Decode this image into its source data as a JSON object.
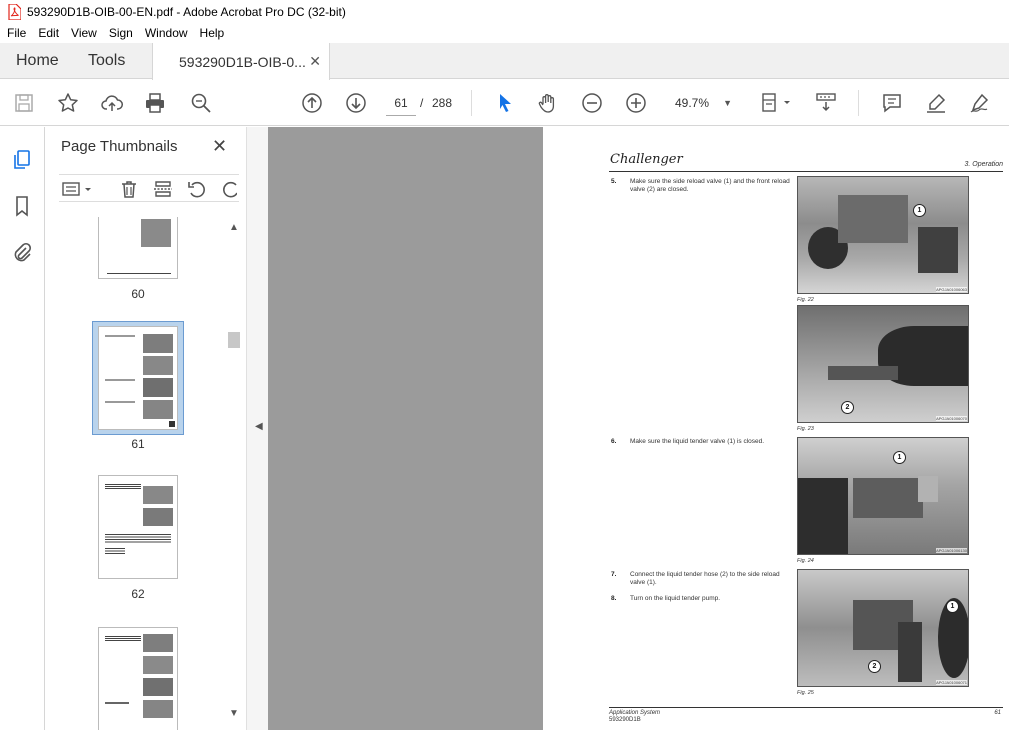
{
  "window": {
    "title": "593290D1B-OIB-00-EN.pdf - Adobe Acrobat Pro DC (32-bit)"
  },
  "menu": [
    "File",
    "Edit",
    "View",
    "Sign",
    "Window",
    "Help"
  ],
  "tabs": {
    "home": "Home",
    "tools": "Tools",
    "document": "593290D1B-OIB-0..."
  },
  "toolbar": {
    "page_current": "61",
    "page_separator": "/",
    "page_total": "288",
    "zoom": "49.7%"
  },
  "panel": {
    "title": "Page Thumbnails"
  },
  "thumbnails": [
    {
      "label": "60"
    },
    {
      "label": "61",
      "selected": true
    },
    {
      "label": "62"
    },
    {
      "label": ""
    }
  ],
  "page": {
    "brand": "Challenger",
    "section": "3. Operation",
    "steps": [
      {
        "num": "5.",
        "text": "Make sure the side reload valve (1) and the front reload valve (2) are closed."
      },
      {
        "num": "6.",
        "text": "Make sure the liquid tender valve (1) is closed."
      },
      {
        "num": "7.",
        "text": "Connect the liquid tender hose (2) to the side reload valve (1)."
      },
      {
        "num": "8.",
        "text": "Turn on the liquid tender pump."
      }
    ],
    "figures": [
      {
        "caption": "Fig. 22",
        "code": "APGJA01006063"
      },
      {
        "caption": "Fig. 23",
        "code": "APGJA01006070"
      },
      {
        "caption": "Fig. 24",
        "code": "APGJA01006130"
      },
      {
        "caption": "Fig. 25",
        "code": "APGJA01006071"
      }
    ],
    "callouts": {
      "one": "1",
      "two": "2"
    },
    "footer_left1": "Application System",
    "footer_left2": "593290D1B",
    "footer_page": "61"
  },
  "colors": {
    "accent": "#1473e6",
    "pdf_red": "#e1251b",
    "doc_bg": "#9b9b9b"
  }
}
